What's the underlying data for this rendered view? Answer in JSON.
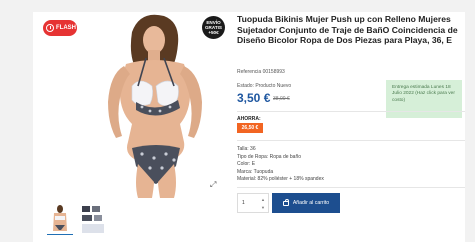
{
  "product": {
    "flash_label": "FLASH",
    "shipping_badge": "ENVÍO GRATIS +50€",
    "title": "Tuopuda Bikinis Mujer Push up con Relleno Mujeres Sujetador Conjunto de Traje de BañO Coincidencia de Diseño Bicolor Ropa de Dos Piezas para Playa, 36, E",
    "reference": "Referencia 00158993",
    "state": "Estado: Producto Nuevo",
    "price": "3,50 €",
    "old_price": "38,00 €",
    "delivery_text": "Entrega estimada Lunes 18 Julio 2022 (Haz click para ver costo)",
    "save_label": "AHORRA:",
    "save_amount": "26,50 €",
    "specs": [
      "Talla: 36",
      "Tipo de Ropa: Ropa de baño",
      "Color: E",
      "Marca: Tuopuda",
      "Material: 82% poliéster + 18% spandex"
    ]
  },
  "cart": {
    "quantity": "1",
    "add_label": "Añadir al carrito"
  },
  "colors": {
    "accent": "#1d4e8f",
    "price": "#1f57a0",
    "flash": "#e63333",
    "save": "#f26522",
    "delivery_bg": "#d6efd8"
  }
}
